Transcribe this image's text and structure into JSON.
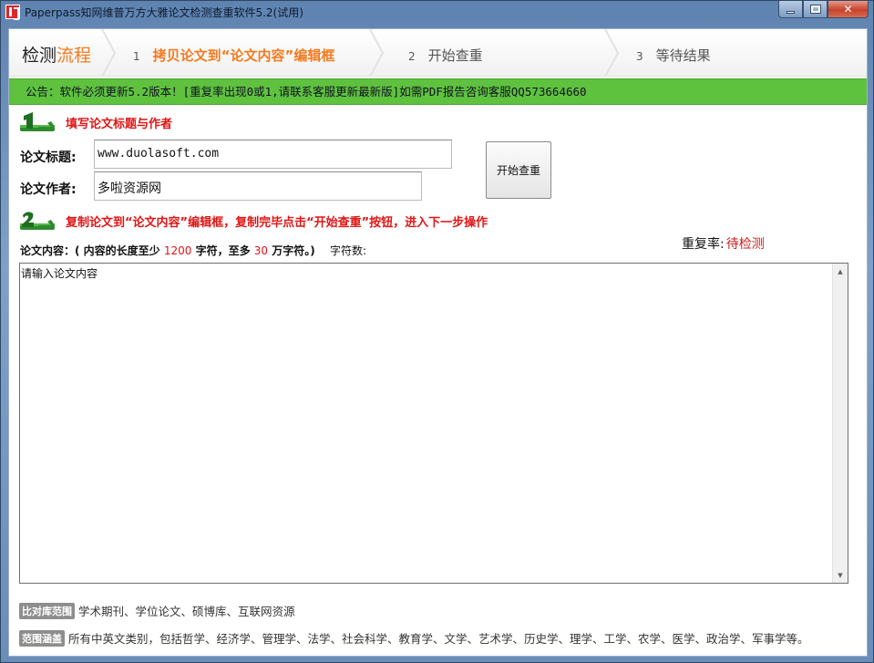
{
  "window": {
    "title": "Paperpass知网维普万方大雅论文检测查重软件5.2(试用)"
  },
  "steps": {
    "title_part1": "检测",
    "title_part2": "流程",
    "items": [
      {
        "num": "1",
        "label": "拷贝论文到“论文内容”编辑框"
      },
      {
        "num": "2",
        "label": "开始查重"
      },
      {
        "num": "3",
        "label": "等待结果"
      }
    ]
  },
  "notice": "公告：软件必须更新5.2版本！[重复率出现0或1,请联系客服更新最新版]如需PDF报告咨询客服QQ573664660",
  "section1": {
    "badge": "1",
    "text": "填写论文标题与作者"
  },
  "form": {
    "title_label": "论文标题:",
    "title_value": "www.duolasoft.com",
    "author_label": "论文作者:",
    "author_value": "多啦资源网",
    "start_button": "开始查重"
  },
  "section2": {
    "badge": "2",
    "text": "复制论文到“论文内容”编辑框，复制完毕点击“开始查重”按钮，进入下一步操作"
  },
  "rate": {
    "label": "重复率:",
    "value": "待检测"
  },
  "content": {
    "desc_prefix": "论文内容：( 内容的长度至少",
    "min": "1200",
    "mid": "字符，至多",
    "max": "30",
    "desc_suffix": "万字符。)",
    "char_count_label": "字符数:",
    "text": "请输入论文内容"
  },
  "footer": {
    "scope_tag": "比对库范围",
    "scope_text": "学术期刊、学位论文、硕博库、互联网资源",
    "range_tag": "范围涵盖",
    "range_text": "所有中英文类别，包括哲学、经济学、管理学、法学、社会科学、教育学、文学、艺术学、历史学、理学、工学、农学、医学、政治学、军事学等。"
  },
  "colors": {
    "accent_orange": "#f47a1f",
    "notice_green": "#5fc23f",
    "alert_red": "#e01515"
  }
}
